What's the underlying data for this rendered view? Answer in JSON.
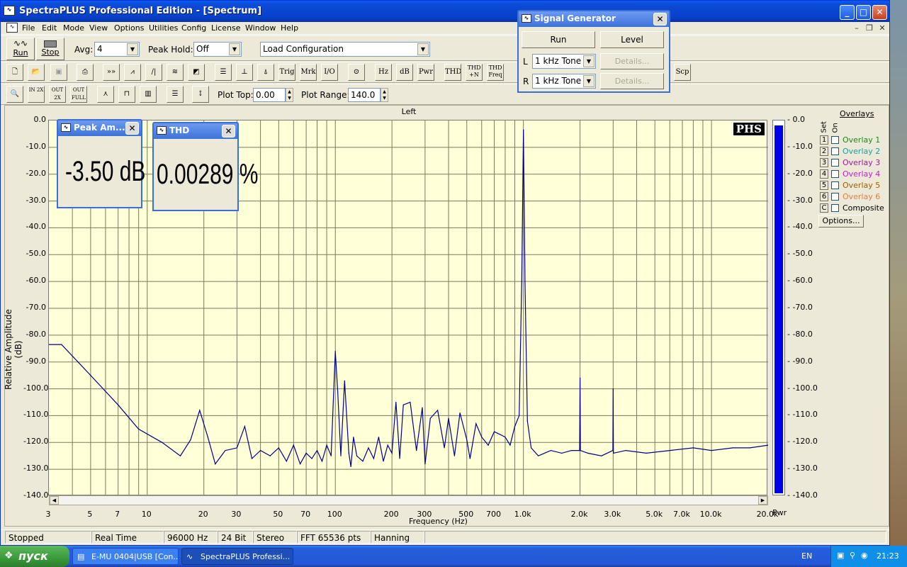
{
  "title": "SpectraPLUS Professional Edition - [Spectrum]",
  "menu": [
    "File",
    "Edit",
    "Mode",
    "View",
    "Options",
    "Utilities",
    "Config",
    "License",
    "Window",
    "Help"
  ],
  "toolbar1": {
    "run": "Run",
    "stop": "Stop",
    "avg_label": "Avg:",
    "avg_value": "4",
    "peak_hold_label": "Peak Hold:",
    "peak_hold_value": "Off",
    "load_config": "Load Configuration"
  },
  "toolbar2": {
    "trig": "Trig",
    "mrk": "Mrk",
    "io": "I/O",
    "hz": "Hz",
    "db": "dB",
    "pwr": "Pwr",
    "thd": "THD",
    "thdn": "THD +N",
    "thdfreq": "THD Freq",
    "scp": "Scp"
  },
  "toolbar3": {
    "plot_top_label": "Plot Top:",
    "plot_top_value": "0.00",
    "plot_range_label": "Plot Range:",
    "plot_range_value": "140.0"
  },
  "plot": {
    "channel_title": "Left",
    "logo": "PHS",
    "pwr_label": "Pwr",
    "x_axis_label": "Frequency (Hz)",
    "y_axis_label": "Relative Amplitude (dB)"
  },
  "chart_data": {
    "type": "line",
    "title": "Left",
    "xlabel": "Frequency (Hz)",
    "ylabel": "Relative Amplitude (dB)",
    "x_scale": "log",
    "xlim": [
      3,
      20000
    ],
    "ylim": [
      -140,
      0
    ],
    "grid": true,
    "y_ticks": [
      "0.0",
      "-10.0",
      "-20.0",
      "-30.0",
      "-40.0",
      "-50.0",
      "-60.0",
      "-70.0",
      "-80.0",
      "-90.0",
      "-100.0",
      "-110.0",
      "-120.0",
      "-130.0",
      "-140.0"
    ],
    "x_ticks": [
      "3",
      "5",
      "7",
      "10",
      "20",
      "30",
      "50",
      "70",
      "100",
      "200",
      "300",
      "500",
      "700",
      "1.0k",
      "2.0k",
      "3.0k",
      "5.0k",
      "7.0k",
      "10.0k",
      "20.0k"
    ],
    "x_tick_values": [
      3,
      5,
      7,
      10,
      20,
      30,
      50,
      70,
      100,
      200,
      300,
      500,
      700,
      1000,
      2000,
      3000,
      5000,
      7000,
      10000,
      20000
    ],
    "series": [
      {
        "color": "#00008b",
        "x": [
          3,
          3.5,
          5,
          7,
          9,
          12,
          15,
          17,
          19,
          21,
          23,
          26,
          30,
          33,
          36,
          40,
          45,
          50,
          55,
          60,
          65,
          70,
          75,
          80,
          85,
          90,
          95,
          100,
          103,
          107,
          112,
          118,
          121,
          125,
          130,
          140,
          150,
          160,
          170,
          180,
          190,
          200,
          210,
          220,
          230,
          250,
          270,
          290,
          300,
          320,
          350,
          380,
          400,
          430,
          460,
          500,
          520,
          560,
          600,
          650,
          700,
          750,
          800,
          850,
          900,
          950,
          980,
          1000,
          1020,
          1050,
          1100,
          1200,
          1400,
          1600,
          1800,
          1990,
          2000,
          2010,
          2200,
          2600,
          2990,
          3000,
          3010,
          3500,
          4500,
          6000,
          8000,
          10000,
          13000,
          16000,
          20000
        ],
        "y": [
          -83.5,
          -83.5,
          -95,
          -106,
          -115,
          -120,
          -125,
          -119,
          -108,
          -118,
          -128,
          -123,
          -122,
          -114,
          -126,
          -123,
          -125,
          -122,
          -127,
          -121,
          -128,
          -124,
          -126,
          -123,
          -127,
          -121,
          -125,
          -86,
          -101,
          -125,
          -97,
          -124,
          -129,
          -118,
          -125,
          -127,
          -122,
          -126,
          -118,
          -127,
          -121,
          -124,
          -105,
          -126,
          -106,
          -105,
          -123,
          -107,
          -128,
          -111,
          -108,
          -122,
          -111,
          -125,
          -109,
          -119,
          -126,
          -113,
          -118,
          -121,
          -116,
          -117,
          -118,
          -121,
          -114,
          -110,
          -60,
          -3.5,
          -60,
          -112,
          -122,
          -125,
          -123,
          -124,
          -123,
          -123,
          -96,
          -123,
          -124,
          -125,
          -123,
          -100,
          -124,
          -123,
          -124,
          -123,
          -122,
          -123,
          -122,
          -122,
          -121
        ]
      }
    ],
    "pwr_level": -1.8,
    "pwr_ticks": [
      "0.0",
      "-10.0",
      "-20.0",
      "-30.0",
      "-40.0",
      "-50.0",
      "-60.0",
      "-70.0",
      "-80.0",
      "-90.0",
      "-100.0",
      "-110.0",
      "-120.0",
      "-130.0",
      "-140.0"
    ]
  },
  "peak_window": {
    "title": "Peak Am...",
    "value": "-3.50 dB"
  },
  "thd_window": {
    "title": "THD",
    "value": "0.00289 %"
  },
  "siggen": {
    "title": "Signal Generator",
    "run": "Run",
    "level": "Level",
    "L": "L",
    "R": "R",
    "l_value": "1 kHz Tone",
    "r_value": "1 kHz Tone",
    "details": "Details..."
  },
  "overlays": {
    "header": "Overlays",
    "set": "Set",
    "on": "On",
    "items": [
      {
        "n": "1",
        "label": "Overlay 1",
        "color": "#1a8a1a"
      },
      {
        "n": "2",
        "label": "Overlay 2",
        "color": "#1aa0a0"
      },
      {
        "n": "3",
        "label": "Overlay 3",
        "color": "#a01aa0"
      },
      {
        "n": "4",
        "label": "Overlay 4",
        "color": "#d01ad0"
      },
      {
        "n": "5",
        "label": "Overlay 5",
        "color": "#a06000"
      },
      {
        "n": "6",
        "label": "Overlay 6",
        "color": "#e08040"
      },
      {
        "n": "C",
        "label": "Composite",
        "color": "#000000"
      }
    ],
    "options": "Options..."
  },
  "status": [
    "Stopped",
    "Real Time",
    "96000 Hz",
    "24 Bit",
    "Stereo",
    "FFT 65536 pts",
    "Hanning"
  ],
  "taskbar": {
    "start": "пуск",
    "tasks": [
      "E-MU 0404|USB [Con...",
      "SpectraPLUS Professi..."
    ],
    "lang": "EN",
    "clock": "21:23"
  }
}
